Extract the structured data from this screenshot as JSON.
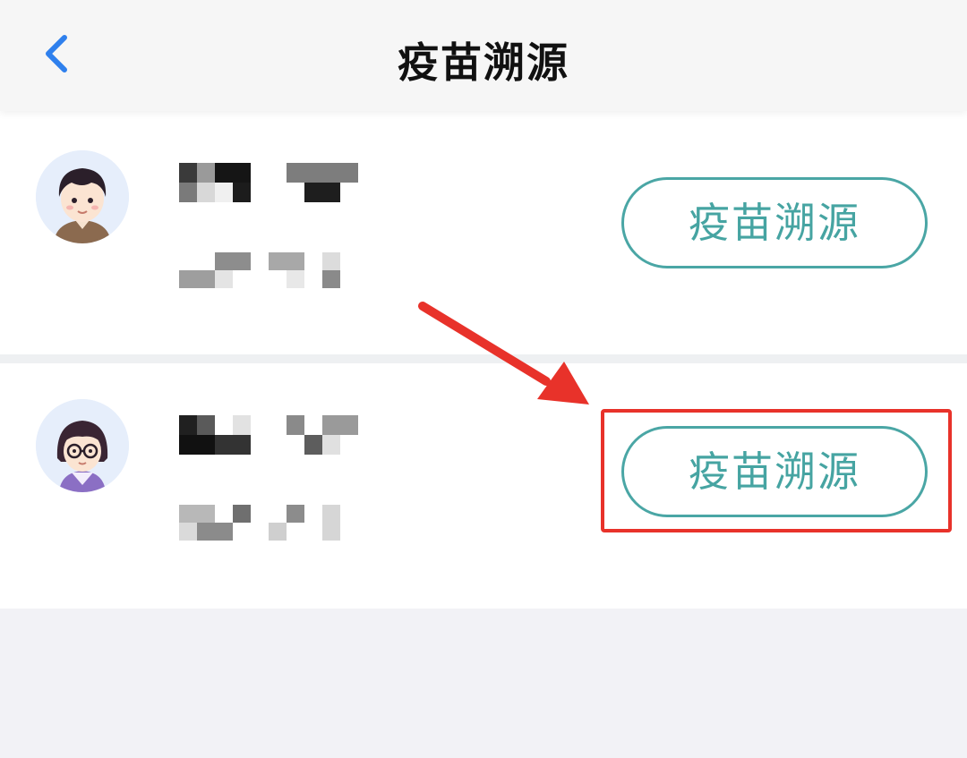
{
  "navbar": {
    "title": "疫苗溯源",
    "back_icon": "chevron-left-icon",
    "back_color": "#2f80ed"
  },
  "members": [
    {
      "avatar_icon": "boy-avatar-icon",
      "name": "",
      "subtitle": "",
      "button_label": "疫苗溯源"
    },
    {
      "avatar_icon": "girl-with-glasses-avatar-icon",
      "name": "",
      "subtitle": "",
      "button_label": "疫苗溯源"
    }
  ],
  "annotation": {
    "highlight_color": "#e8322a",
    "arrow_icon": "red-arrow-icon"
  },
  "colors": {
    "button_accent": "#46a4a2",
    "page_background": "#f2f2f6"
  }
}
